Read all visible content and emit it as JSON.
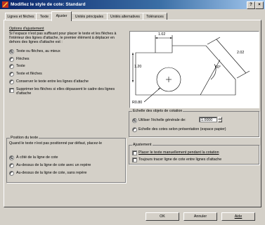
{
  "window": {
    "title": "Modifiez le style de cote: Standard",
    "help_button": "?",
    "close_button": "×"
  },
  "tabs": [
    {
      "label": "Lignes et flèches",
      "active": false
    },
    {
      "label": "Texte",
      "active": false
    },
    {
      "label": "Ajuster",
      "active": true
    },
    {
      "label": "Unités principales",
      "active": false
    },
    {
      "label": "Unités alternatives",
      "active": false
    },
    {
      "label": "Tolérances",
      "active": false
    }
  ],
  "fit_options": {
    "title": "Options d'ajustement",
    "description": "Si l'espace n'est pas suffisant pour placer le texte et les flèches à l'intérieur des lignes d'attache, le premier élément à déplacer en dehors des lignes d'attache est :",
    "radios": [
      {
        "label": "Texte ou flèches, au mieux",
        "selected": true
      },
      {
        "label": "Flèches",
        "selected": false
      },
      {
        "label": "Texte",
        "selected": false
      },
      {
        "label": "Texte et flèches",
        "selected": false
      },
      {
        "label": "Conserver le texte entre les lignes d'attache",
        "selected": false
      }
    ],
    "checkbox": {
      "label": "Supprimer les flèches si elles dépassent le cadre des lignes d'attache",
      "checked": false
    }
  },
  "text_position": {
    "title": "Position du texte",
    "description": "Quand le texte n'est pas positionné par défaut, placez-le",
    "radios": [
      {
        "label": "À côté de la ligne de cote",
        "selected": true
      },
      {
        "label": "Au-dessus de la ligne de cote avec un repère",
        "selected": false
      },
      {
        "label": "Au-dessus de la ligne de cote, sans repère",
        "selected": false
      }
    ]
  },
  "preview": {
    "dim_top": "1.02",
    "dim_left": "1.20",
    "dim_right": "2.02",
    "dim_angle": "60°",
    "dim_radius": "R0.80"
  },
  "scale": {
    "title": "Echelle des objets de cotation",
    "radios": [
      {
        "label": "Utiliser l'échelle générale de:",
        "selected": true
      },
      {
        "label": "Echelle des cotes selon présentation (espace papier)",
        "selected": false
      }
    ],
    "value": "1.0000"
  },
  "fine_tuning": {
    "title": "Ajustement",
    "checks": [
      {
        "label": "Placer le texte manuellement pendant la cotation",
        "checked": false
      },
      {
        "label": "Toujours tracer ligne de cote entre lignes d'attache",
        "checked": false
      }
    ]
  },
  "buttons": {
    "ok": "OK",
    "cancel": "Annuler",
    "help": "Aide"
  },
  "colors": {
    "title_start": "#0a246a",
    "title_end": "#a6caf0",
    "face": "#d4d0c8"
  }
}
